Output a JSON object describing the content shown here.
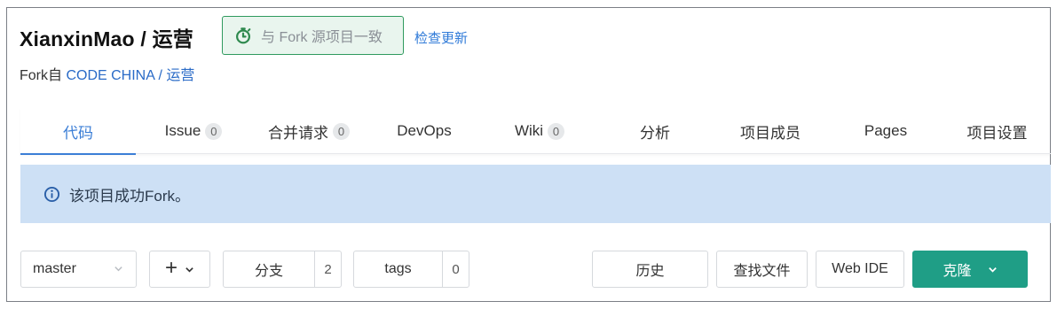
{
  "header": {
    "repo_title": "XianxinMao / 运营",
    "sync_status": "与 Fork 源项目一致",
    "check_update": "检查更新",
    "forked_prefix": "Fork自 ",
    "forked_from": "CODE CHINA / 运营"
  },
  "tabs": [
    {
      "label": "代码",
      "active": true
    },
    {
      "label": "Issue",
      "count": "0"
    },
    {
      "label": "合并请求",
      "count": "0"
    },
    {
      "label": "DevOps"
    },
    {
      "label": "Wiki",
      "count": "0"
    },
    {
      "label": "分析"
    },
    {
      "label": "项目成员"
    },
    {
      "label": "Pages"
    },
    {
      "label": "项目设置"
    }
  ],
  "alert": {
    "icon": "info-icon",
    "message": "该项目成功Fork。"
  },
  "toolbar": {
    "branch_value": "master",
    "add_icon": "plus-icon",
    "branches_label": "分支",
    "branches_count": "2",
    "tags_label": "tags",
    "tags_count": "0",
    "history_label": "历史",
    "find_file_label": "查找文件",
    "web_ide_label": "Web IDE",
    "clone_label": "克隆"
  },
  "colors": {
    "accent": "#3b7ed6",
    "sync_border": "#2f9a5e",
    "alert_bg": "#cde0f5",
    "clone_bg": "#1f9e86"
  }
}
